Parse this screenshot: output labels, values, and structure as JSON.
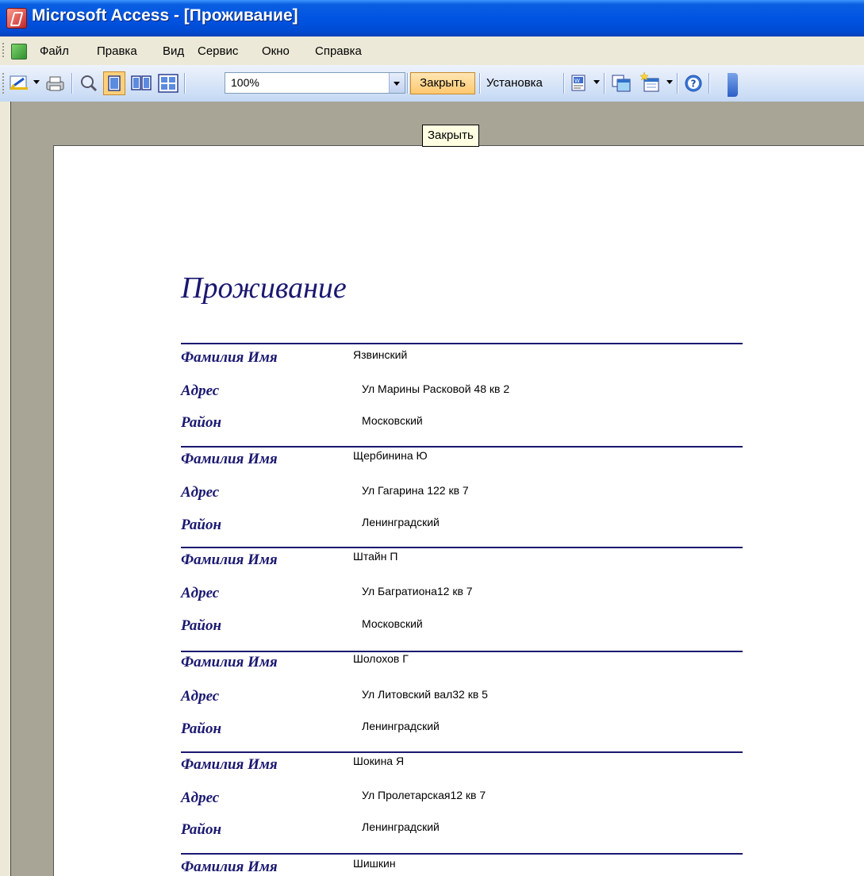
{
  "window": {
    "title": "Microsoft Access - [Проживание]"
  },
  "menu": [
    "Файл",
    "Правка",
    "Вид",
    "Сервис",
    "Окно",
    "Справка"
  ],
  "toolbar": {
    "zoom": "100%",
    "close_label": "Закрыть",
    "setup_label": "Установка",
    "icons": [
      "view-design-icon",
      "print-icon",
      "zoom-icon",
      "one-page-icon",
      "two-pages-icon",
      "multiple-pages-icon",
      "office-links-icon",
      "database-window-icon",
      "new-object-icon",
      "help-icon"
    ]
  },
  "tooltip": "Закрыть",
  "report": {
    "title": "Проживание",
    "labels": {
      "name": "Фамилия Имя",
      "address": "Адрес",
      "district": "Район"
    },
    "records": [
      {
        "name": "Язвинский",
        "address": "Ул Марины Расковой 48 кв 2",
        "district": "Московский"
      },
      {
        "name": "Щербинина  Ю",
        "address": "Ул Гагарина 122 кв 7",
        "district": "Ленинградский"
      },
      {
        "name": "Штайн  П",
        "address": "Ул Багратиона12 кв 7",
        "district": "Московский"
      },
      {
        "name": "Шолохов  Г",
        "address": "Ул Литовский вал32 кв 5",
        "district": "Ленинградский"
      },
      {
        "name": "Шокина  Я",
        "address": "Ул Пролетарская12 кв 7",
        "district": "Ленинградский"
      },
      {
        "name": "Шишкин"
      }
    ]
  }
}
